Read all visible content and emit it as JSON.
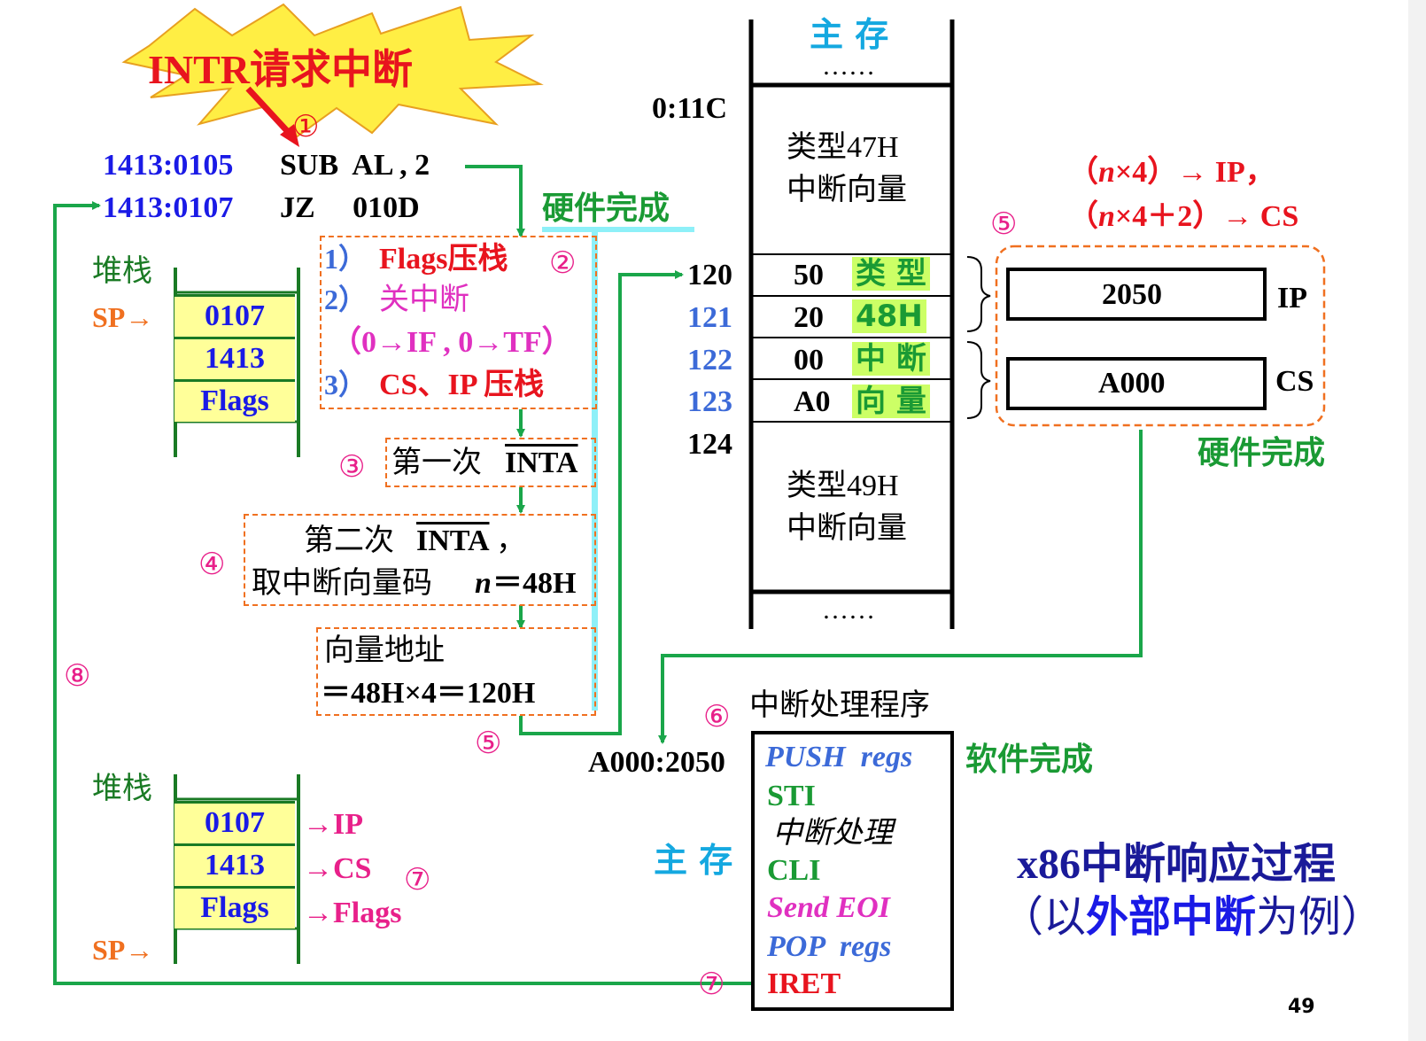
{
  "burst": {
    "text": "INTR请求中断",
    "color": "#e8141e",
    "fill": "#ffee44"
  },
  "circled": {
    "c1": "①",
    "c2": "②",
    "c3": "③",
    "c4": "④",
    "c5": "⑤",
    "c6": "⑥",
    "c7": "⑦",
    "c8": "⑧"
  },
  "code": {
    "line1": {
      "addr": "1413:0105",
      "instr": "SUB  AL , 2"
    },
    "line2": {
      "addr": "1413:0107",
      "instr": "JZ     010D"
    }
  },
  "hardware_label": "硬件完成",
  "software_label": "软件完成",
  "steps": {
    "s2": {
      "l1_num": "1）",
      "l1_text": "Flags压栈",
      "l2_num": "2）",
      "l2_text": "关中断",
      "l3": "（0→IF , 0→TF）",
      "l4_num": "3）",
      "l4_text": "CS、IP 压栈"
    },
    "s3": {
      "prefix": "第一次 ",
      "signal": "INTA"
    },
    "s4": {
      "l1_prefix": "第二次 ",
      "l1_signal": "INTA",
      "l1_suffix": "，",
      "l2_prefix": "取中断向量码 ",
      "l2_n": "n",
      "l2_suffix": "＝48H"
    },
    "s5": {
      "l1": "向量地址",
      "l2": "＝48H×4＝120H"
    }
  },
  "stack_top": {
    "label": "堆栈",
    "sp": "SP→",
    "cells": [
      "0107",
      "1413",
      "Flags"
    ]
  },
  "stack_bottom": {
    "label": "堆栈",
    "sp": "SP→",
    "cells": [
      "0107",
      "1413",
      "Flags"
    ],
    "targets": [
      "→IP",
      "→CS",
      "→Flags"
    ]
  },
  "memory": {
    "title": "主 存",
    "dots_top": "……",
    "dots_bottom": "……",
    "addr_11c": "0:11C",
    "addrs": [
      "120",
      "121",
      "122",
      "123",
      "124"
    ],
    "type47": [
      "类型47H",
      "中断向量"
    ],
    "type49": [
      "类型49H",
      "中断向量"
    ],
    "bytes": [
      "50",
      "20",
      "00",
      "A0"
    ],
    "hl_labels": [
      "类 型",
      "48H",
      "中 断",
      "向 量"
    ]
  },
  "formula": {
    "l1_open": "（",
    "l1_n": "n",
    "l1_rest": "×4）→ IP，",
    "l2_open": "（",
    "l2_n": "n",
    "l2_rest": "×4＋2）→ CS"
  },
  "regs": {
    "ip_value": "2050",
    "ip_label": "IP",
    "cs_value": "A000",
    "cs_label": "CS"
  },
  "handler": {
    "title": "中断处理程序",
    "entry": "A000:2050",
    "mem_label": "主 存",
    "lines": [
      "PUSH  regs",
      "STI",
      "中断处理",
      "CLI",
      "Send EOI",
      "POP  regs",
      "IRET"
    ]
  },
  "caption": {
    "l1": "x86中断响应过程",
    "l2_open": "（以",
    "l2_mid": "外部中断",
    "l2_close": "为例）"
  },
  "page_number": "49"
}
